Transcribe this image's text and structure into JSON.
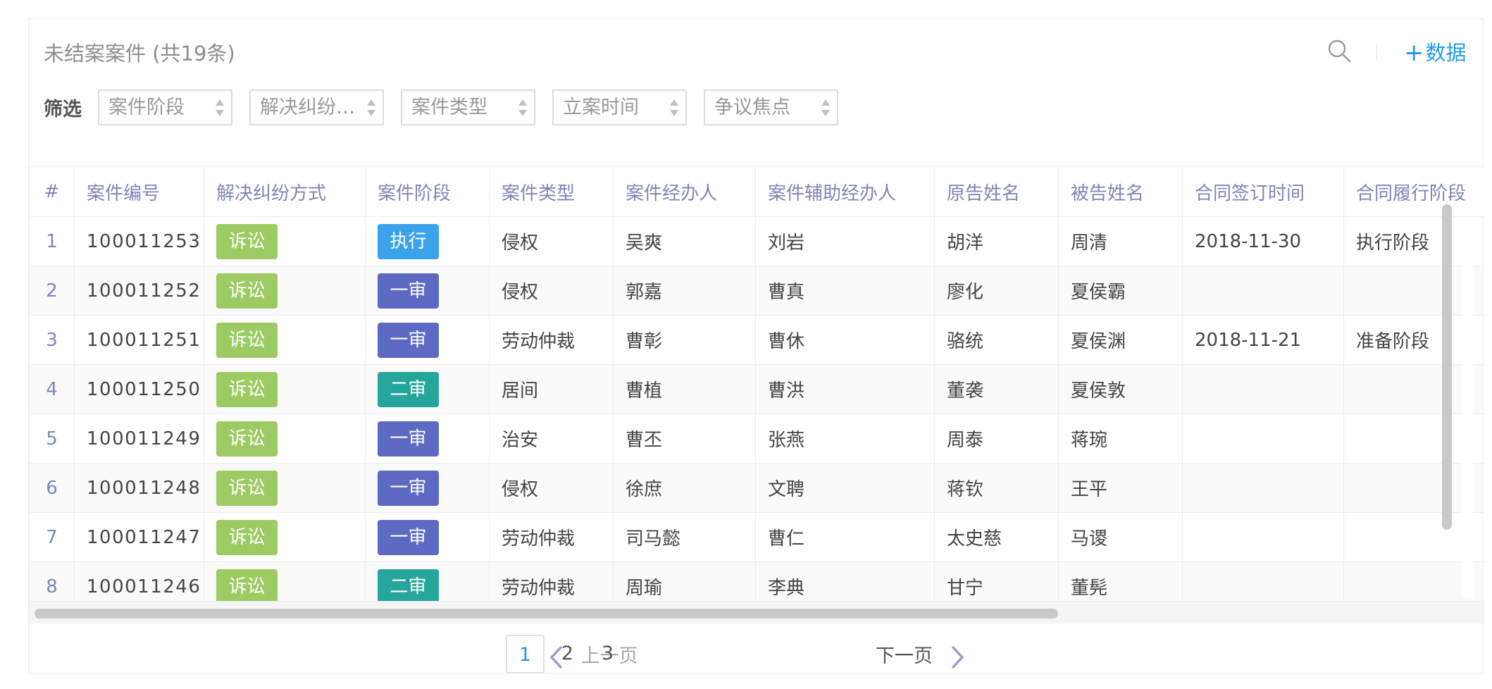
{
  "header": {
    "title": "未结案案件 (共19条)",
    "add_label": "数据",
    "add_plus": "+"
  },
  "filters": {
    "label": "筛选",
    "items": [
      "案件阶段",
      "解决纠纷…",
      "案件类型",
      "立案时间",
      "争议焦点"
    ]
  },
  "table": {
    "columns": [
      "#",
      "案件编号",
      "解决纠纷方式",
      "案件阶段",
      "案件类型",
      "案件经办人",
      "案件辅助经办人",
      "原告姓名",
      "被告姓名",
      "合同签订时间",
      "合同履行阶段"
    ],
    "rows": [
      {
        "idx": "1",
        "id": "100011253",
        "method": "诉讼",
        "stage": "执行",
        "type": "侵权",
        "handler": "吴爽",
        "assistant": "刘岩",
        "plaintiff": "胡洋",
        "defendant": "周清",
        "sign_date": "2018-11-30",
        "perform_stage": "执行阶段"
      },
      {
        "idx": "2",
        "id": "100011252",
        "method": "诉讼",
        "stage": "一审",
        "type": "侵权",
        "handler": "郭嘉",
        "assistant": "曹真",
        "plaintiff": "廖化",
        "defendant": "夏侯霸",
        "sign_date": "",
        "perform_stage": ""
      },
      {
        "idx": "3",
        "id": "100011251",
        "method": "诉讼",
        "stage": "一审",
        "type": "劳动仲裁",
        "handler": "曹彰",
        "assistant": "曹休",
        "plaintiff": "骆统",
        "defendant": "夏侯渊",
        "sign_date": "2018-11-21",
        "perform_stage": "准备阶段"
      },
      {
        "idx": "4",
        "id": "100011250",
        "method": "诉讼",
        "stage": "二审",
        "type": "居间",
        "handler": "曹植",
        "assistant": "曹洪",
        "plaintiff": "董袭",
        "defendant": "夏侯敦",
        "sign_date": "",
        "perform_stage": ""
      },
      {
        "idx": "5",
        "id": "100011249",
        "method": "诉讼",
        "stage": "一审",
        "type": "治安",
        "handler": "曹丕",
        "assistant": "张燕",
        "plaintiff": "周泰",
        "defendant": "蒋琬",
        "sign_date": "",
        "perform_stage": ""
      },
      {
        "idx": "6",
        "id": "100011248",
        "method": "诉讼",
        "stage": "一审",
        "type": "侵权",
        "handler": "徐庶",
        "assistant": "文聘",
        "plaintiff": "蒋钦",
        "defendant": "王平",
        "sign_date": "",
        "perform_stage": ""
      },
      {
        "idx": "7",
        "id": "100011247",
        "method": "诉讼",
        "stage": "一审",
        "type": "劳动仲裁",
        "handler": "司马懿",
        "assistant": "曹仁",
        "plaintiff": "太史慈",
        "defendant": "马谡",
        "sign_date": "",
        "perform_stage": ""
      },
      {
        "idx": "8",
        "id": "100011246",
        "method": "诉讼",
        "stage": "二审",
        "type": "劳动仲裁",
        "handler": "周瑜",
        "assistant": "李典",
        "plaintiff": "甘宁",
        "defendant": "董髡",
        "sign_date": "",
        "perform_stage": ""
      }
    ]
  },
  "tag_colors": {
    "诉讼": "#9dcb63",
    "执行": "#3aa3ec",
    "一审": "#5c6ac4",
    "二审": "#26a69a"
  },
  "pagination": {
    "prev_label": "上一页",
    "next_label": "下一页",
    "pages": [
      "1",
      "2",
      "3"
    ],
    "current": "1"
  },
  "icons": {
    "search": "search-icon",
    "prev": "chevron-left-icon",
    "next": "chevron-right-icon",
    "sort": "sort-arrows-icon"
  }
}
